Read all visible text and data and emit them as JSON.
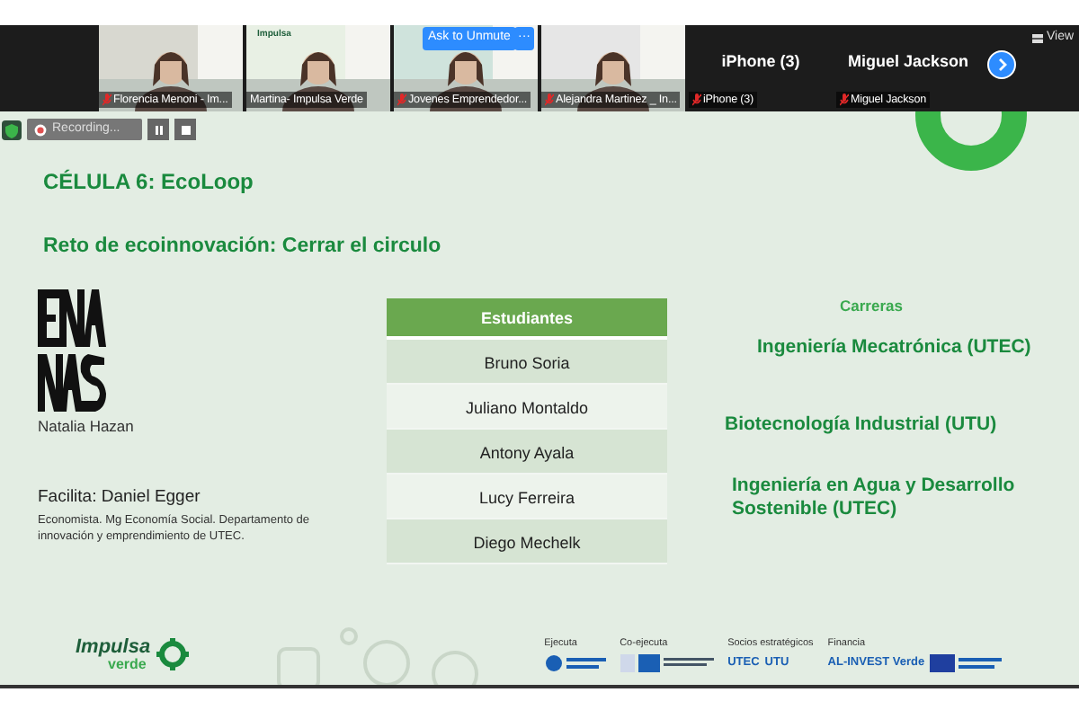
{
  "participants": [
    {
      "kind": "video",
      "name": "Florencia Menoni - Im...",
      "muted": true
    },
    {
      "kind": "video",
      "name": "Martina- Impulsa Verde",
      "muted": false,
      "logo": "Impulsa"
    },
    {
      "kind": "video",
      "name": "Jovenes Emprendedor...",
      "muted": true,
      "ask_unmute": "Ask to Unmute",
      "more": "···"
    },
    {
      "kind": "video",
      "name": "Alejandra Martinez _ In...",
      "muted": true
    },
    {
      "kind": "name",
      "title": "iPhone (3)",
      "name": "iPhone (3)",
      "muted": true
    },
    {
      "kind": "name",
      "title": "Miguel Jackson",
      "name": "Miguel Jackson",
      "muted": true
    }
  ],
  "view_button": "View",
  "recording": {
    "label": "Recording..."
  },
  "slide": {
    "title": "CÉLULA 6: EcoLoop",
    "subtitle": "Reto de ecoinnovación: Cerrar el circulo",
    "person_name": "Natalia Hazan",
    "facilitator": "Facilita: Daniel Egger",
    "facilitator_bio": "Economista. Mg Economía Social. Departamento de innovación y emprendimiento de UTEC.",
    "students_header": "Estudiantes",
    "students": [
      "Bruno Soria",
      "Juliano Montaldo",
      "Antony Ayala",
      "Lucy Ferreira",
      "Diego Mechelk"
    ],
    "careers_header": "Carreras",
    "careers": [
      "Ingeniería Mecatrónica (UTEC)",
      "Biotecnología Industrial (UTU)",
      "Ingeniería en Agua y Desarrollo Sostenible  (UTEC)"
    ],
    "footer": {
      "brand": "Impulsa",
      "brand_sub": "verde",
      "groups": [
        {
          "label": "Ejecuta"
        },
        {
          "label": "Co-ejecuta"
        },
        {
          "label": "Socios estratégicos",
          "texts": [
            "UTEC",
            "UTU"
          ]
        },
        {
          "label": "Financia",
          "texts": [
            "AL-INVEST Verde"
          ]
        }
      ]
    }
  }
}
